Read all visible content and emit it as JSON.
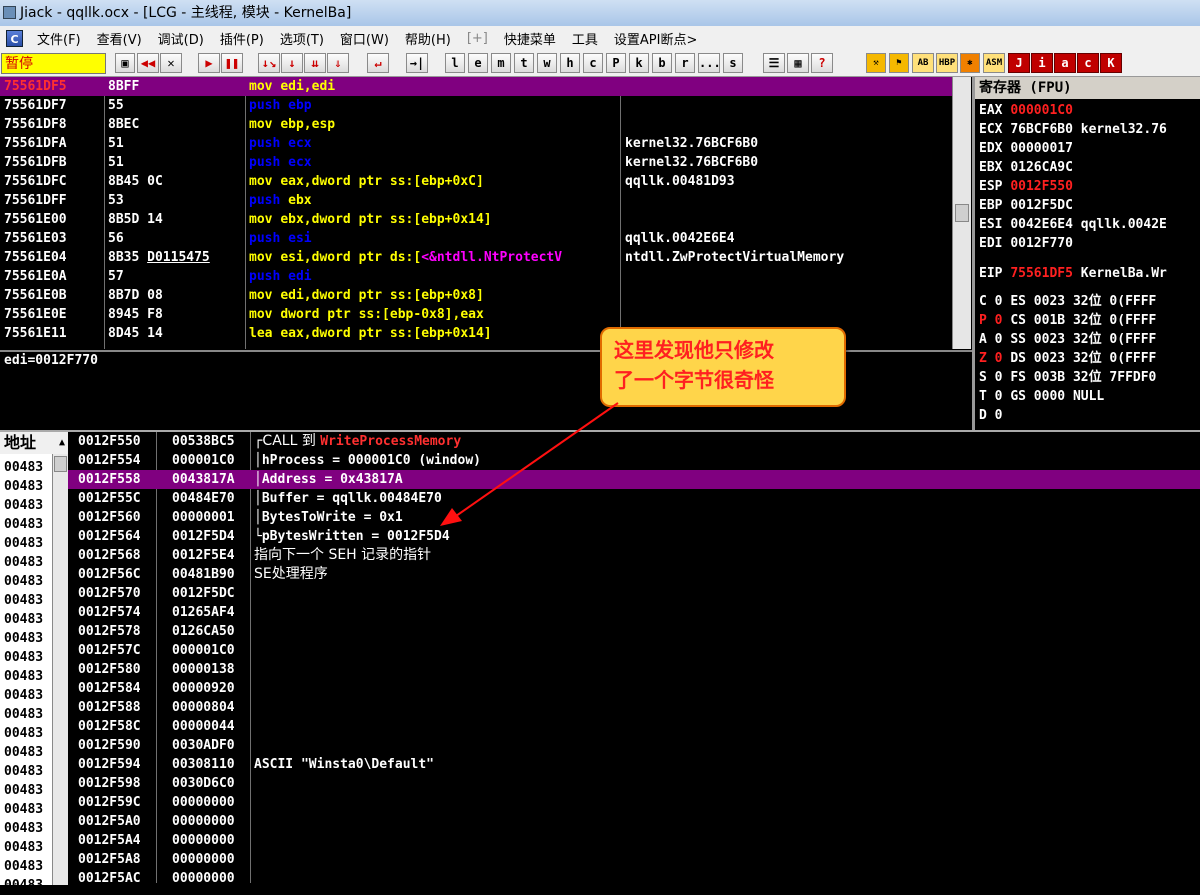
{
  "window": {
    "title": "Jiack   - qqllk.ocx - [LCG - 主线程, 模块 - KernelBa]"
  },
  "menu": [
    "文件(F)",
    "查看(V)",
    "调试(D)",
    "插件(P)",
    "选项(T)",
    "窗口(W)",
    "帮助(H)",
    "[+]",
    "快捷菜单",
    "工具",
    "设置API断点>"
  ],
  "app_icon": "C",
  "status": "暂停",
  "toolbar": {
    "buttons": [
      "l",
      "e",
      "m",
      "t",
      "w",
      "h",
      "c",
      "P",
      "k",
      "b",
      "r",
      "...",
      "s"
    ],
    "ab": "AB",
    "hbp": "HBP",
    "asm": "ASM",
    "brand": [
      "J",
      "i",
      "a",
      "c",
      "K"
    ]
  },
  "disasm": [
    {
      "addr": "75561DF5",
      "hex": "8BFF",
      "asm": [
        [
          "mov ",
          "k-mov"
        ],
        [
          "edi,edi",
          "k-reg"
        ]
      ],
      "cmt": "",
      "sel": true
    },
    {
      "addr": "75561DF7",
      "hex": "55",
      "asm": [
        [
          "push ",
          "k-push"
        ],
        [
          "ebp",
          "k-push"
        ]
      ],
      "cmt": ""
    },
    {
      "addr": "75561DF8",
      "hex": "8BEC",
      "asm": [
        [
          "mov ",
          "k-mov"
        ],
        [
          "ebp,esp",
          "k-reg"
        ]
      ],
      "cmt": ""
    },
    {
      "addr": "75561DFA",
      "hex": "51",
      "asm": [
        [
          "push ",
          "k-push"
        ],
        [
          "ecx",
          "k-push"
        ]
      ],
      "cmt": "kernel32.76BCF6B0"
    },
    {
      "addr": "75561DFB",
      "hex": "51",
      "asm": [
        [
          "push ",
          "k-push"
        ],
        [
          "ecx",
          "k-push"
        ]
      ],
      "cmt": "kernel32.76BCF6B0"
    },
    {
      "addr": "75561DFC",
      "hex": "8B45 0C",
      "asm": [
        [
          "mov ",
          "k-mov"
        ],
        [
          "eax,dword ptr ss:[ebp+0xC]",
          "k-ptr"
        ]
      ],
      "cmt": "qqllk.00481D93"
    },
    {
      "addr": "75561DFF",
      "hex": "53",
      "asm": [
        [
          "push ",
          "k-push"
        ],
        [
          "ebx",
          "k-mov"
        ]
      ],
      "cmt": ""
    },
    {
      "addr": "75561E00",
      "hex": "8B5D 14",
      "asm": [
        [
          "mov ",
          "k-mov"
        ],
        [
          "ebx,dword ptr ss:[ebp+0x14]",
          "k-ptr"
        ]
      ],
      "cmt": ""
    },
    {
      "addr": "75561E03",
      "hex": "56",
      "asm": [
        [
          "push ",
          "k-push"
        ],
        [
          "esi",
          "k-push"
        ]
      ],
      "cmt": "qqllk.0042E6E4"
    },
    {
      "addr": "75561E04",
      "hex": "8B35 D0115475",
      "asm": [
        [
          "mov ",
          "k-mov"
        ],
        [
          "esi,dword ptr ds:[",
          "k-ptr"
        ],
        [
          "<&ntdll.NtProtectV",
          "k-mag"
        ]
      ],
      "cmt": "ntdll.ZwProtectVirtualMemory"
    },
    {
      "addr": "75561E0A",
      "hex": "57",
      "asm": [
        [
          "push ",
          "k-push"
        ],
        [
          "edi",
          "k-push"
        ]
      ],
      "cmt": ""
    },
    {
      "addr": "75561E0B",
      "hex": "8B7D 08",
      "asm": [
        [
          "mov ",
          "k-mov"
        ],
        [
          "edi,dword ptr ss:[ebp+0x8]",
          "k-ptr"
        ]
      ],
      "cmt": ""
    },
    {
      "addr": "75561E0E",
      "hex": "8945 F8",
      "asm": [
        [
          "mov ",
          "k-mov"
        ],
        [
          "dword ptr ss:[ebp-0x8],eax",
          "k-ptr"
        ]
      ],
      "cmt": ""
    },
    {
      "addr": "75561E11",
      "hex": "8D45 14",
      "asm": [
        [
          "lea ",
          "k-mov"
        ],
        [
          "eax,dword ptr ss:[ebp+0x14]",
          "k-ptr"
        ]
      ],
      "cmt": ""
    }
  ],
  "info_line": "edi=0012F770",
  "registers": {
    "header": "寄存器 (FPU)",
    "lines": [
      {
        "label": "EAX ",
        "val": "000001C0",
        "red": true,
        "rest": ""
      },
      {
        "label": "ECX ",
        "val": "76BCF6B0",
        "red": false,
        "rest": " kernel32.76"
      },
      {
        "label": "EDX ",
        "val": "00000017",
        "red": false,
        "rest": ""
      },
      {
        "label": "EBX ",
        "val": "0126CA9C",
        "red": false,
        "rest": ""
      },
      {
        "label": "ESP ",
        "val": "0012F550",
        "red": true,
        "rest": ""
      },
      {
        "label": "EBP ",
        "val": "0012F5DC",
        "red": false,
        "rest": ""
      },
      {
        "label": "ESI ",
        "val": "0042E6E4",
        "red": false,
        "rest": " qqllk.0042E"
      },
      {
        "label": "EDI ",
        "val": "0012F770",
        "red": false,
        "rest": ""
      }
    ],
    "eip": {
      "label": "EIP ",
      "val": "75561DF5",
      "rest": " KernelBa.Wr"
    },
    "flags": [
      {
        "f": "C 0",
        "seg": "ES 0023",
        "bits": "32位",
        "rest": "0(FFFF"
      },
      {
        "f": "P 0",
        "seg": "CS 001B",
        "bits": "32位",
        "rest": "0(FFFF"
      },
      {
        "f": "A 0",
        "seg": "SS 0023",
        "bits": "32位",
        "rest": "0(FFFF"
      },
      {
        "f": "Z 0",
        "seg": "DS 0023",
        "bits": "32位",
        "rest": "0(FFFF"
      },
      {
        "f": "S 0",
        "seg": "FS 003B",
        "bits": "32位",
        "rest": "7FFDF0"
      },
      {
        "f": "T 0",
        "seg": "GS 0000",
        "bits": "NULL",
        "rest": ""
      },
      {
        "f": "D 0",
        "seg": "",
        "bits": "",
        "rest": ""
      }
    ]
  },
  "dump": {
    "header": "地址",
    "rows": [
      "00483",
      "00483",
      "00483",
      "00483",
      "00483",
      "00483",
      "00483",
      "00483",
      "00483",
      "00483",
      "00483",
      "00483",
      "00483",
      "00483",
      "00483",
      "00483",
      "00483",
      "00483",
      "00483",
      "00483",
      "00483",
      "00483",
      "00483"
    ]
  },
  "stack": [
    {
      "addr": "0012F550",
      "val": "00538BC5",
      "cmt": [
        [
          "┌CALL 到 ",
          "w"
        ],
        [
          "WriteProcessMemory",
          "m"
        ]
      ]
    },
    {
      "addr": "0012F554",
      "val": "000001C0",
      "cmt": [
        [
          "│hProcess = 000001C0 (window)",
          "w"
        ]
      ]
    },
    {
      "addr": "0012F558",
      "val": "0043817A",
      "cmt": [
        [
          "│Address = 0x43817A",
          "w"
        ]
      ],
      "sel": true
    },
    {
      "addr": "0012F55C",
      "val": "00484E70",
      "cmt": [
        [
          "│Buffer = qqllk.00484E70",
          "w"
        ]
      ]
    },
    {
      "addr": "0012F560",
      "val": "00000001",
      "cmt": [
        [
          "│BytesToWrite = 0x1",
          "w"
        ]
      ]
    },
    {
      "addr": "0012F564",
      "val": "0012F5D4",
      "cmt": [
        [
          "└pBytesWritten = 0012F5D4",
          "w"
        ]
      ]
    },
    {
      "addr": "0012F568",
      "val": "0012F5E4",
      "cmt": [
        [
          "指向下一个 SEH 记录的指针",
          "w"
        ]
      ]
    },
    {
      "addr": "0012F56C",
      "val": "00481B90",
      "cmt": [
        [
          "SE处理程序",
          "w"
        ]
      ]
    },
    {
      "addr": "0012F570",
      "val": "0012F5DC",
      "cmt": []
    },
    {
      "addr": "0012F574",
      "val": "01265AF4",
      "cmt": []
    },
    {
      "addr": "0012F578",
      "val": "0126CA50",
      "cmt": []
    },
    {
      "addr": "0012F57C",
      "val": "000001C0",
      "cmt": []
    },
    {
      "addr": "0012F580",
      "val": "00000138",
      "cmt": []
    },
    {
      "addr": "0012F584",
      "val": "00000920",
      "cmt": []
    },
    {
      "addr": "0012F588",
      "val": "00000804",
      "cmt": []
    },
    {
      "addr": "0012F58C",
      "val": "00000044",
      "cmt": []
    },
    {
      "addr": "0012F590",
      "val": "0030ADF0",
      "cmt": []
    },
    {
      "addr": "0012F594",
      "val": "00308110",
      "cmt": [
        [
          "ASCII \"Winsta0\\Default\"",
          "w"
        ]
      ]
    },
    {
      "addr": "0012F598",
      "val": "0030D6C0",
      "cmt": []
    },
    {
      "addr": "0012F59C",
      "val": "00000000",
      "cmt": []
    },
    {
      "addr": "0012F5A0",
      "val": "00000000",
      "cmt": []
    },
    {
      "addr": "0012F5A4",
      "val": "00000000",
      "cmt": []
    },
    {
      "addr": "0012F5A8",
      "val": "00000000",
      "cmt": []
    },
    {
      "addr": "0012F5AC",
      "val": "00000000",
      "cmt": []
    }
  ],
  "callout": {
    "line1": "这里发现他只修改",
    "line2": "了一个字节很奇怪"
  }
}
